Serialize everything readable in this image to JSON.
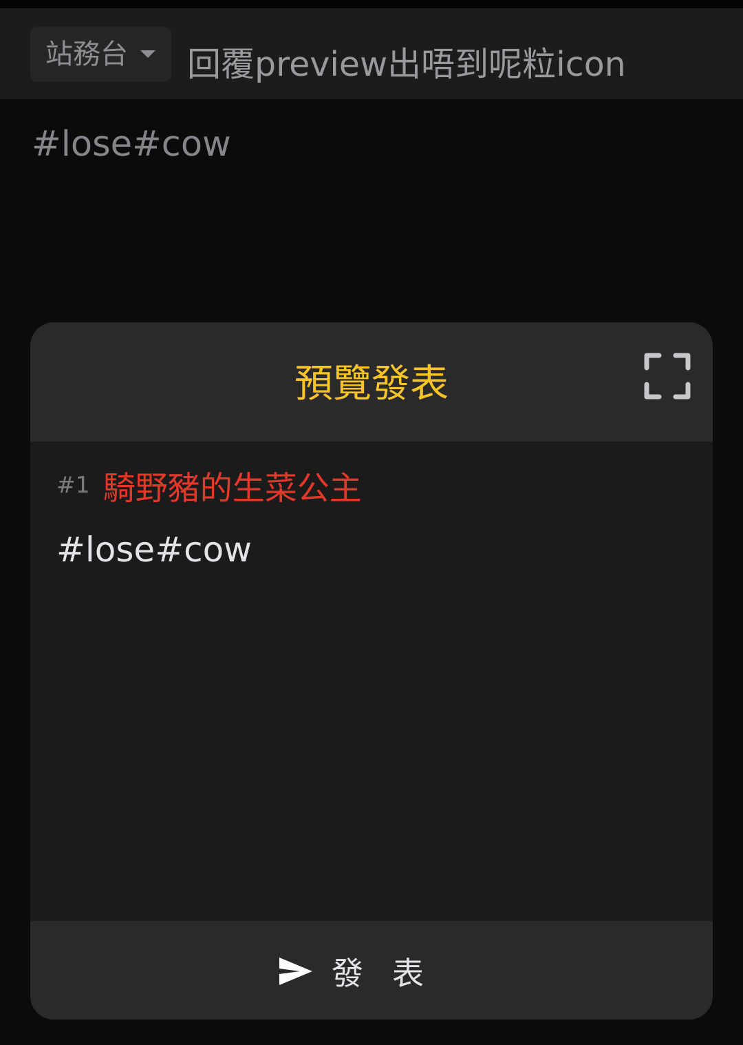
{
  "header": {
    "category": "站務台",
    "title": "回覆preview出唔到呢粒icon"
  },
  "editor": {
    "body": "#lose#cow"
  },
  "preview_modal": {
    "title": "預覽發表",
    "post": {
      "number": "#1",
      "author": "騎野豬的生菜公主",
      "content": "#lose#cow"
    },
    "submit_label": "發表"
  },
  "colors": {
    "background": "#0b0b0c",
    "title_bar": "#1c1c1d",
    "modal_header": "#2a2a2b",
    "modal_body": "#1b1b1c",
    "modal_title": "#f6c428",
    "author_name": "#e2382a"
  },
  "icons": {
    "dropdown": "chevron-down-icon",
    "fullscreen": "fullscreen-icon",
    "send": "send-icon"
  }
}
